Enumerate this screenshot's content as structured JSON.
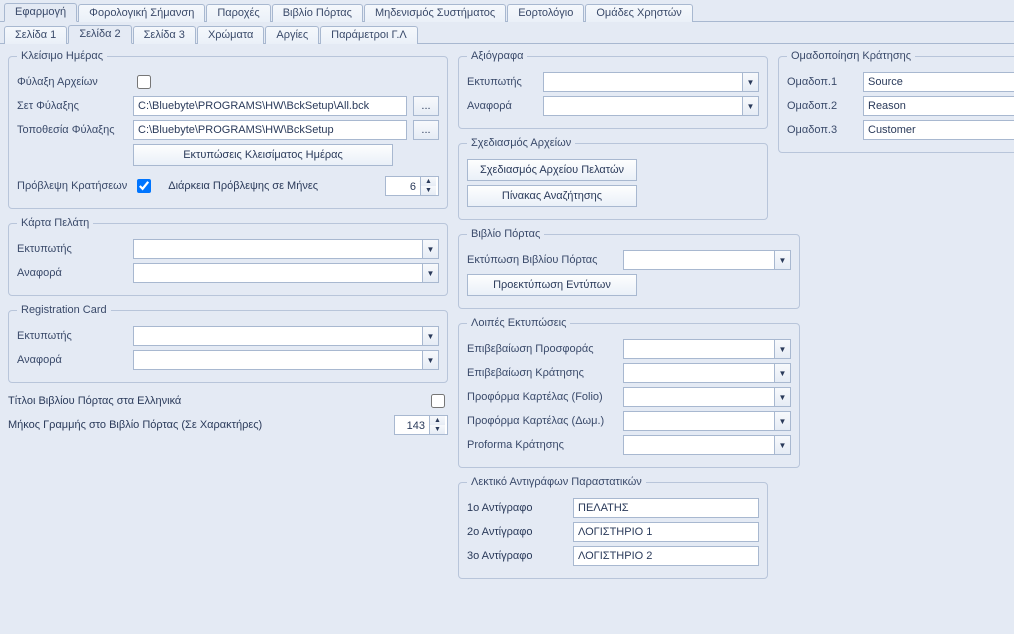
{
  "topTabs": [
    "Εφαρμογή",
    "Φορολογική Σήμανση",
    "Παροχές",
    "Βιβλίο Πόρτας",
    "Μηδενισμός Συστήματος",
    "Εορτολόγιο",
    "Ομάδες Χρηστών"
  ],
  "activeTopTab": 0,
  "subTabs": [
    "Σελίδα 1",
    "Σελίδα 2",
    "Σελίδα 3",
    "Χρώματα",
    "Αργίες",
    "Παράμετροι Γ.Λ"
  ],
  "activeSubTab": 1,
  "dayClose": {
    "legend": "Κλείσιμο Ημέρας",
    "archiveLabel": "Φύλαξη Αρχείων",
    "archiveChecked": false,
    "setLabel": "Σετ Φύλαξης",
    "setValue": "C:\\Bluebyte\\PROGRAMS\\HW\\BckSetup\\All.bck",
    "locLabel": "Τοποθεσία Φύλαξης",
    "locValue": "C:\\Bluebyte\\PROGRAMS\\HW\\BckSetup",
    "printBtn": "Εκτυπώσεις Κλεισίματος Ημέρας",
    "forecastLabel": "Πρόβλεψη Κρατήσεων",
    "forecastChecked": true,
    "forecastMonthsLabel": "Διάρκεια Πρόβλεψης σε Μήνες",
    "forecastMonths": "6"
  },
  "customerCard": {
    "legend": "Κάρτα Πελάτη",
    "printerLabel": "Εκτυπωτής",
    "printerValue": "",
    "reportLabel": "Αναφορά",
    "reportValue": ""
  },
  "regCard": {
    "legend": "Registration Card",
    "printerLabel": "Εκτυπωτής",
    "printerValue": "",
    "reportLabel": "Αναφορά",
    "reportValue": ""
  },
  "doorBookExtra": {
    "greekTitlesLabel": "Τίτλοι Βιβλίου Πόρτας στα Ελληνικά",
    "greekTitlesChecked": false,
    "lineLenLabel": "Μήκος Γραμμής στο Βιβλίο Πόρτας (Σε Χαρακτήρες)",
    "lineLen": "143"
  },
  "axiografa": {
    "legend": "Αξιόγραφα",
    "printerLabel": "Εκτυπωτής",
    "printerValue": "",
    "reportLabel": "Αναφορά",
    "reportValue": ""
  },
  "fileDesign": {
    "legend": "Σχεδιασμός Αρχείων",
    "btn1": "Σχεδιασμός Αρχείου Πελατών",
    "btn2": "Πίνακας Αναζήτησης"
  },
  "doorBook": {
    "legend": "Βιβλίο Πόρτας",
    "printLabel": "Εκτύπωση Βιβλίου Πόρτας",
    "printValue": "",
    "btn": "Προεκτύπωση Εντύπων"
  },
  "otherPrints": {
    "legend": "Λοιπές Εκτυπώσεις",
    "items": [
      {
        "label": "Επιβεβαίωση Προσφοράς",
        "value": ""
      },
      {
        "label": "Επιβεβαίωση Κράτησης",
        "value": ""
      },
      {
        "label": "Προφόρμα Καρτέλας (Folio)",
        "value": ""
      },
      {
        "label": "Προφόρμα Καρτέλας (Δωμ.)",
        "value": ""
      },
      {
        "label": "Proforma Κράτησης",
        "value": ""
      }
    ]
  },
  "copies": {
    "legend": "Λεκτικό Αντιγράφων Παραστατικών",
    "items": [
      {
        "label": "1ο Αντίγραφο",
        "value": "ΠΕΛΑΤΗΣ"
      },
      {
        "label": "2ο Αντίγραφο",
        "value": "ΛΟΓΙΣΤΗΡΙΟ 1"
      },
      {
        "label": "3ο Αντίγραφο",
        "value": "ΛΟΓΙΣΤΗΡΙΟ 2"
      }
    ]
  },
  "grouping": {
    "legend": "Ομαδοποίηση Κράτησης",
    "items": [
      {
        "label": "Ομαδοπ.1",
        "value": "Source"
      },
      {
        "label": "Ομαδοπ.2",
        "value": "Reason"
      },
      {
        "label": "Ομαδοπ.3",
        "value": "Customer"
      }
    ]
  }
}
